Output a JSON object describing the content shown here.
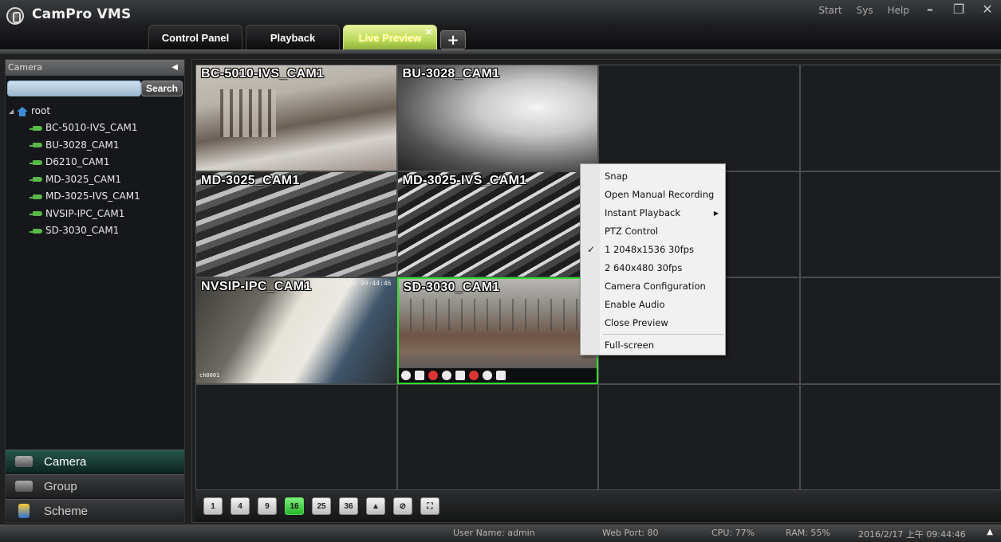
{
  "app": {
    "title": "CamPro VMS"
  },
  "topmenu": [
    "Start",
    "Sys",
    "Help"
  ],
  "tabs": [
    {
      "label": "Control Panel"
    },
    {
      "label": "Playback"
    },
    {
      "label": "Live Preview"
    }
  ],
  "sidebar": {
    "header": "Camera",
    "search_button": "Search",
    "search_value": "",
    "root": "root",
    "cameras": [
      "BC-5010-IVS_CAM1",
      "BU-3028_CAM1",
      "D6210_CAM1",
      "MD-3025_CAM1",
      "MD-3025-IVS_CAM1",
      "NVSIP-IPC_CAM1",
      "SD-3030_CAM1"
    ],
    "nav": [
      "Camera",
      "Group",
      "Scheme"
    ]
  },
  "feeds": [
    {
      "label": "BC-5010-IVS_CAM1"
    },
    {
      "label": "BU-3028_CAM1"
    },
    {
      "label": "MD-3025_CAM1"
    },
    {
      "label": "MD-3025-IVS_CAM1"
    },
    {
      "label": "NVSIP-IPC_CAM1",
      "timestamp": "02-17-2016 09:44:46",
      "overlay": "ch0001"
    },
    {
      "label": "SD-3030_CAM1"
    }
  ],
  "layout_buttons": [
    "1",
    "4",
    "9",
    "16",
    "25",
    "36"
  ],
  "context_menu": {
    "items": [
      "Snap",
      "Open Manual Recording",
      "Instant Playback",
      "PTZ Control",
      "1 2048x1536 30fps",
      "2 640x480 30fps",
      "Camera Configuration",
      "Enable Audio",
      "Close Preview"
    ],
    "last": "Full-screen"
  },
  "status": {
    "user": "User Name: admin",
    "port": "Web Port: 80",
    "cpu": "CPU: 77%",
    "ram": "RAM: 55%",
    "datetime": "2016/2/17 上午 09:44:46"
  }
}
